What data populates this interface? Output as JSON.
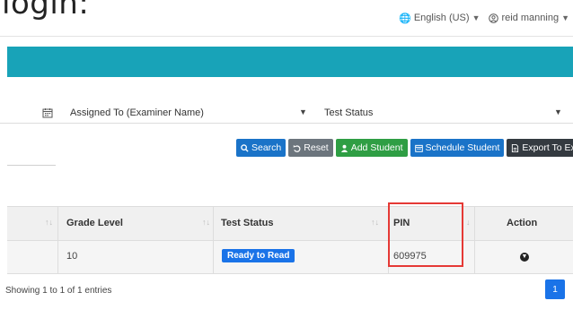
{
  "caption": "login:",
  "topbar": {
    "language": "English (US)",
    "user": "reid manning"
  },
  "filters": {
    "assigned_to": "Assigned To (Examiner Name)",
    "test_status": "Test Status"
  },
  "buttons": {
    "search": "Search",
    "reset": "Reset",
    "add_student": "Add Student",
    "schedule_student": "Schedule Student",
    "export": "Export To Excel"
  },
  "table": {
    "headers": {
      "grade_level": "Grade Level",
      "test_status": "Test Status",
      "pin": "PIN",
      "action": "Action"
    },
    "rows": [
      {
        "grade_level": "10",
        "test_status": "Ready to Read",
        "pin": "609975"
      }
    ]
  },
  "footer": {
    "entries": "Showing 1 to 1 of 1 entries",
    "page": "1"
  },
  "colors": {
    "banner": "#18a3b8",
    "primary": "#1a73c8",
    "success": "#2f9e44",
    "secondary": "#6c757d",
    "dark": "#343a40",
    "highlight": "#e53935"
  }
}
